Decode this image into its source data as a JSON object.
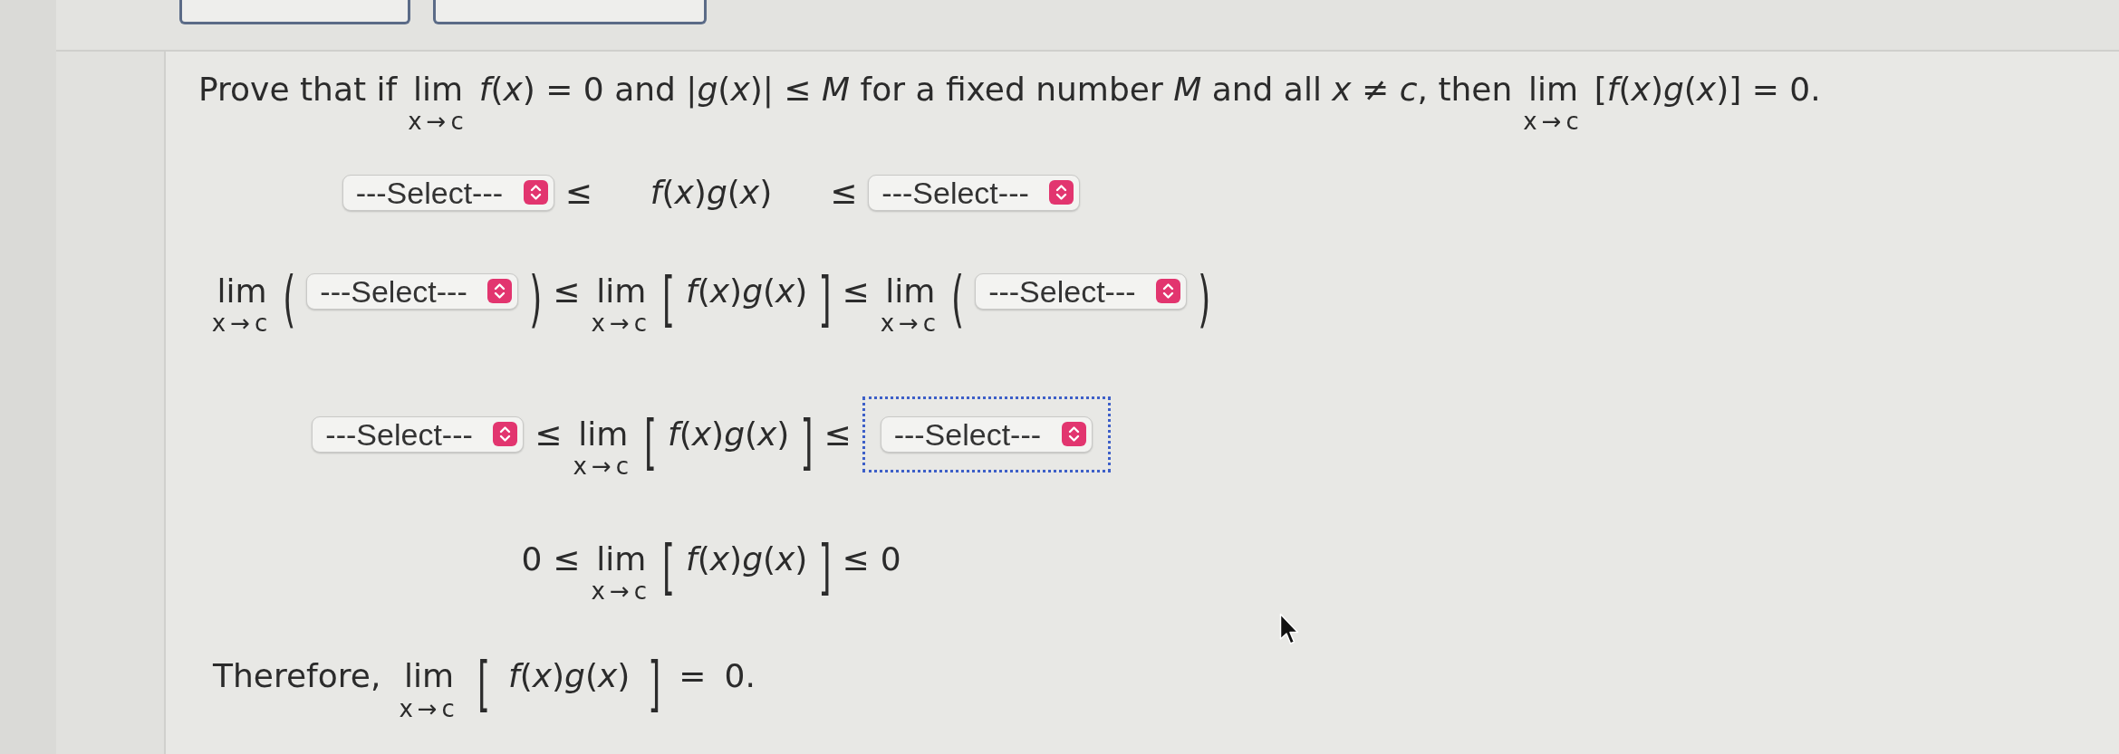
{
  "problem": {
    "segments": [
      {
        "kind": "text",
        "text": "Prove that if"
      },
      {
        "kind": "limit",
        "label": "lim",
        "sub": "x→c"
      },
      {
        "kind": "text",
        "text": "*f*(*x*) = 0 and |*g*(*x*)| ≤ *M* for a fixed number *M* and all *x* ≠ *c*, then"
      },
      {
        "kind": "limit",
        "label": "lim",
        "sub": "x→c"
      },
      {
        "kind": "text",
        "text": "[*f*(*x*)*g*(*x*)] = 0."
      }
    ]
  },
  "steps": [
    {
      "parts": [
        {
          "kind": "select",
          "value": "---Select---",
          "focused": false
        },
        {
          "kind": "rel",
          "text": "≤"
        },
        {
          "kind": "expr",
          "text": "*f*(*x*)*g*(*x*)"
        },
        {
          "kind": "rel",
          "text": "≤"
        },
        {
          "kind": "select",
          "value": "---Select---",
          "focused": false
        }
      ]
    },
    {
      "parts": [
        {
          "kind": "limit",
          "label": "lim",
          "sub": "x→c"
        },
        {
          "kind": "paren",
          "text": "("
        },
        {
          "kind": "select",
          "value": "---Select---",
          "focused": false
        },
        {
          "kind": "paren",
          "text": ")"
        },
        {
          "kind": "rel",
          "text": "≤"
        },
        {
          "kind": "limit",
          "label": "lim",
          "sub": "x→c"
        },
        {
          "kind": "bracket",
          "text": "["
        },
        {
          "kind": "expr",
          "text": "*f*(*x*)*g*(*x*)"
        },
        {
          "kind": "bracket",
          "text": "]"
        },
        {
          "kind": "rel",
          "text": "≤"
        },
        {
          "kind": "limit",
          "label": "lim",
          "sub": "x→c"
        },
        {
          "kind": "paren",
          "text": "("
        },
        {
          "kind": "select",
          "value": "---Select---",
          "focused": false
        },
        {
          "kind": "paren",
          "text": ")"
        }
      ]
    },
    {
      "parts": [
        {
          "kind": "select",
          "value": "---Select---",
          "focused": false
        },
        {
          "kind": "rel",
          "text": "≤"
        },
        {
          "kind": "limit",
          "label": "lim",
          "sub": "x→c"
        },
        {
          "kind": "bracket",
          "text": "["
        },
        {
          "kind": "expr",
          "text": "*f*(*x*)*g*(*x*)"
        },
        {
          "kind": "bracket",
          "text": "]"
        },
        {
          "kind": "rel",
          "text": "≤"
        },
        {
          "kind": "select",
          "value": "---Select---",
          "focused": true
        }
      ]
    },
    {
      "parts": [
        {
          "kind": "expr",
          "text": "0"
        },
        {
          "kind": "rel",
          "text": "≤"
        },
        {
          "kind": "limit",
          "label": "lim",
          "sub": "x→c"
        },
        {
          "kind": "bracket",
          "text": "["
        },
        {
          "kind": "expr",
          "text": "*f*(*x*)*g*(*x*)"
        },
        {
          "kind": "bracket",
          "text": "]"
        },
        {
          "kind": "rel",
          "text": "≤"
        },
        {
          "kind": "expr",
          "text": "0"
        }
      ]
    }
  ],
  "conclusion": {
    "parts": [
      {
        "kind": "text",
        "text": "Therefore,"
      },
      {
        "kind": "limit",
        "label": "lim",
        "sub": "x→c"
      },
      {
        "kind": "bracket",
        "text": "["
      },
      {
        "kind": "expr",
        "text": "*f*(*x*)*g*(*x*)"
      },
      {
        "kind": "bracket",
        "text": "]"
      },
      {
        "kind": "rel",
        "text": "="
      },
      {
        "kind": "expr",
        "text": "0."
      }
    ]
  }
}
